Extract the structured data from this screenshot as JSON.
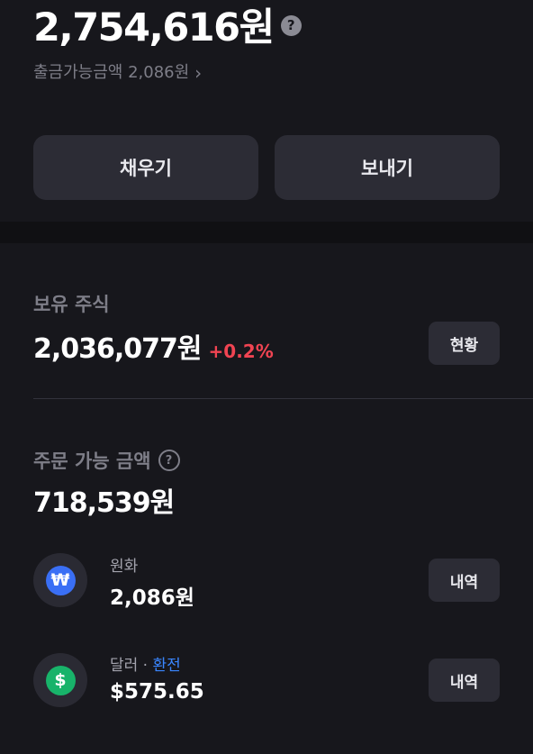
{
  "account": {
    "total_amount": "2,754,616원",
    "help_symbol": "?",
    "withdrawable": "출금가능금액 2,086원",
    "chevron": "›"
  },
  "actions": {
    "fill_label": "채우기",
    "send_label": "보내기"
  },
  "holdings": {
    "title": "보유 주식",
    "amount": "2,036,077원",
    "change": "+0.2%",
    "status_button": "현황"
  },
  "orderable": {
    "title": "주문 가능 금액",
    "help_symbol": "?",
    "amount": "718,539원",
    "currencies": [
      {
        "label": "원화",
        "value": "2,086원",
        "icon": "won-icon",
        "symbol": "₩",
        "button": "내역"
      },
      {
        "label": "달러",
        "separator": " · ",
        "link": "환전",
        "value": "$575.65",
        "icon": "dollar-icon",
        "symbol": "$",
        "button": "내역"
      }
    ]
  },
  "colors": {
    "background": "#17171c",
    "button": "#2c2c35",
    "positive_change": "#f04452",
    "link": "#3a86ff",
    "won_icon": "#3a6ff5",
    "dollar_icon": "#18b36a"
  }
}
